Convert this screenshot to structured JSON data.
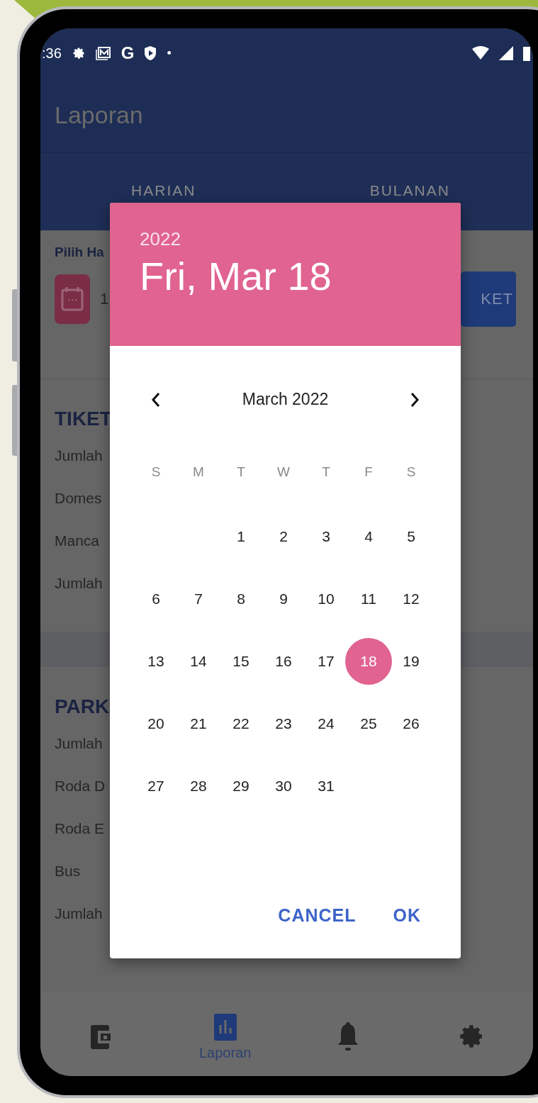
{
  "status_bar": {
    "time": ":36",
    "google_mark": "G",
    "dot": "•"
  },
  "app_bar": {
    "title": "Laporan"
  },
  "tabs": [
    {
      "label": "HARIAN"
    },
    {
      "label": "BULANAN"
    }
  ],
  "date_filter": {
    "label": "Pilih Ha",
    "value": "1",
    "button": "KET"
  },
  "sections": [
    {
      "title": "TIKET",
      "rows": [
        "Jumlah",
        "Domes",
        "Manca",
        "Jumlah"
      ]
    },
    {
      "title": "PARK",
      "rows": [
        "Jumlah",
        "Roda D",
        "Roda E",
        "Bus",
        "Jumlah"
      ]
    }
  ],
  "dialog": {
    "year": "2022",
    "date": "Fri, Mar 18",
    "month": "March 2022",
    "weekdays": [
      "S",
      "M",
      "T",
      "W",
      "T",
      "F",
      "S"
    ],
    "weeks": [
      [
        {
          "kind": "blank"
        },
        {
          "kind": "blank"
        },
        {
          "day": "1",
          "selected": false
        },
        {
          "day": "2",
          "selected": false
        },
        {
          "day": "3",
          "selected": false
        },
        {
          "day": "4",
          "selected": false
        },
        {
          "day": "5",
          "selected": false
        }
      ],
      [
        {
          "day": "6",
          "selected": false
        },
        {
          "day": "7",
          "selected": false
        },
        {
          "day": "8",
          "selected": false
        },
        {
          "day": "9",
          "selected": false
        },
        {
          "day": "10",
          "selected": false
        },
        {
          "day": "11",
          "selected": false
        },
        {
          "day": "12",
          "selected": false
        }
      ],
      [
        {
          "day": "13",
          "selected": false
        },
        {
          "day": "14",
          "selected": false
        },
        {
          "day": "15",
          "selected": false
        },
        {
          "day": "16",
          "selected": false
        },
        {
          "day": "17",
          "selected": false
        },
        {
          "day": "18",
          "selected": true
        },
        {
          "day": "19",
          "selected": false
        }
      ],
      [
        {
          "day": "20",
          "selected": false
        },
        {
          "day": "21",
          "selected": false
        },
        {
          "day": "22",
          "selected": false
        },
        {
          "day": "23",
          "selected": false
        },
        {
          "day": "24",
          "selected": false
        },
        {
          "day": "25",
          "selected": false
        },
        {
          "day": "26",
          "selected": false
        }
      ],
      [
        {
          "day": "27",
          "selected": false
        },
        {
          "day": "28",
          "selected": false
        },
        {
          "day": "29",
          "selected": false
        },
        {
          "day": "30",
          "selected": false
        },
        {
          "day": "31",
          "selected": false
        },
        {
          "kind": "blank"
        },
        {
          "kind": "blank"
        }
      ]
    ],
    "buttons": [
      "CANCEL",
      "OK"
    ]
  },
  "bottom_nav": [
    {
      "kind": "wallet",
      "selected": false
    },
    {
      "kind": "chart",
      "label": "Laporan",
      "selected": true
    },
    {
      "kind": "bell",
      "selected": false
    },
    {
      "kind": "gear",
      "selected": false
    }
  ]
}
